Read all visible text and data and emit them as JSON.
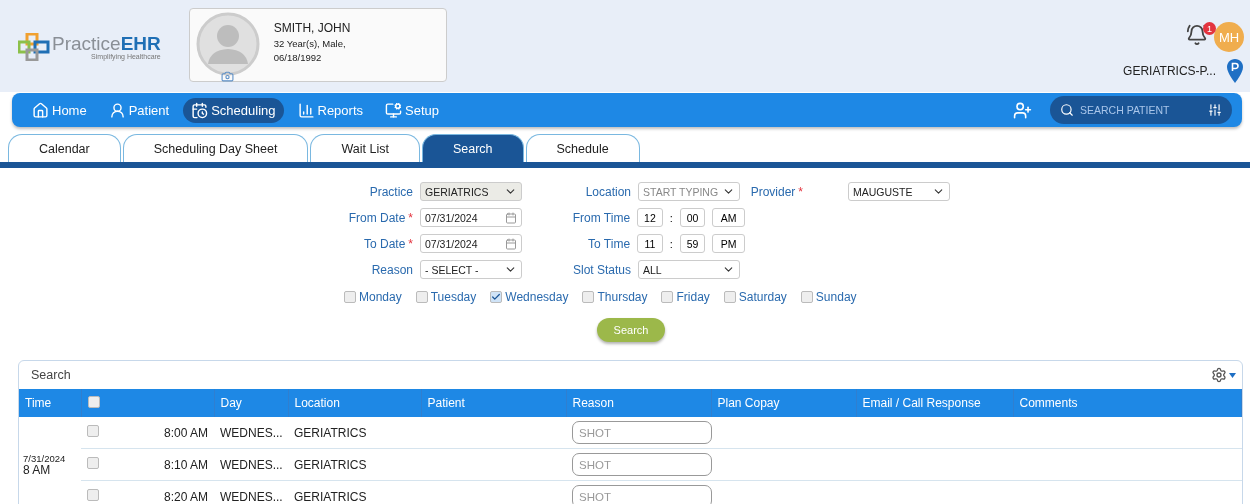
{
  "logo": {
    "name_a": "Practice",
    "name_b": "EHR",
    "tagline": "Simplifying Healthcare"
  },
  "patient": {
    "name": "SMITH, JOHN",
    "age_sex": "32 Year(s), Male,",
    "dob": "06/18/1992"
  },
  "notifications": {
    "count": "1"
  },
  "user": {
    "initials": "MH"
  },
  "facility": "GERIATRICS-P...",
  "nav": [
    {
      "label": "Home",
      "selected": false
    },
    {
      "label": "Patient",
      "selected": false
    },
    {
      "label": "Scheduling",
      "selected": true
    },
    {
      "label": "Reports",
      "selected": false
    },
    {
      "label": "Setup",
      "selected": false
    }
  ],
  "search_patient": {
    "placeholder": "SEARCH PATIENT"
  },
  "tabs": [
    {
      "label": "Calendar",
      "selected": false
    },
    {
      "label": "Scheduling Day Sheet",
      "selected": false
    },
    {
      "label": "Wait List",
      "selected": false
    },
    {
      "label": "Search",
      "selected": true
    },
    {
      "label": "Schedule",
      "selected": false
    }
  ],
  "form": {
    "rows": [
      [
        {
          "kind": "select",
          "label": "Practice",
          "value": "GERIATRICS",
          "disabled": true
        },
        {
          "kind": "select",
          "label": "Location",
          "placeholder": "START TYPING",
          "disabled": false
        },
        {
          "kind": "select",
          "label": "Provider",
          "required_mark": "*",
          "value": "MAUGUSTE",
          "disabled": false
        }
      ],
      [
        {
          "kind": "date",
          "label": "From Date",
          "required_mark": "*",
          "value": "07/31/2024"
        },
        {
          "kind": "time",
          "label": "From Time",
          "hour": "12",
          "separator": ":",
          "minute": "00",
          "period": "AM"
        }
      ],
      [
        {
          "kind": "date",
          "label": "To Date",
          "required_mark": "*",
          "value": "07/31/2024"
        },
        {
          "kind": "time",
          "label": "To Time",
          "hour": "11",
          "separator": ":",
          "minute": "59",
          "period": "PM"
        }
      ],
      [
        {
          "kind": "select",
          "label": "Reason",
          "value": "- SELECT -",
          "disabled": false
        },
        {
          "kind": "select",
          "label": "Slot Status",
          "value": "ALL",
          "disabled": false
        }
      ]
    ],
    "days": [
      {
        "label": "Monday",
        "checked": false
      },
      {
        "label": "Tuesday",
        "checked": false
      },
      {
        "label": "Wednesday",
        "checked": true
      },
      {
        "label": "Thursday",
        "checked": false
      },
      {
        "label": "Friday",
        "checked": false
      },
      {
        "label": "Saturday",
        "checked": false
      },
      {
        "label": "Sunday",
        "checked": false
      }
    ],
    "search_button": "Search"
  },
  "results": {
    "title": "Search",
    "columns": [
      {
        "kind": "text",
        "label": "Time"
      },
      {
        "kind": "checkbox",
        "checked": false
      },
      {
        "kind": "text",
        "label": "Day"
      },
      {
        "kind": "text",
        "label": "Location"
      },
      {
        "kind": "text",
        "label": "Patient"
      },
      {
        "kind": "text",
        "label": "Reason"
      },
      {
        "kind": "text",
        "label": "Plan Copay"
      },
      {
        "kind": "text",
        "label": "Email / Call Response"
      },
      {
        "kind": "text",
        "label": "Comments"
      }
    ],
    "groups": [
      {
        "date": "7/31/2024",
        "hour": "8 AM",
        "slots": [
          {
            "checked": false,
            "time": "8:00 AM",
            "day": "WEDNES...",
            "location": "GERIATRICS",
            "reason_placeholder": "SHOT"
          },
          {
            "checked": false,
            "time": "8:10 AM",
            "day": "WEDNES...",
            "location": "GERIATRICS",
            "reason_placeholder": "SHOT"
          },
          {
            "checked": false,
            "time": "8:20 AM",
            "day": "WEDNES...",
            "location": "GERIATRICS",
            "reason_placeholder": "SHOT"
          }
        ]
      }
    ]
  }
}
